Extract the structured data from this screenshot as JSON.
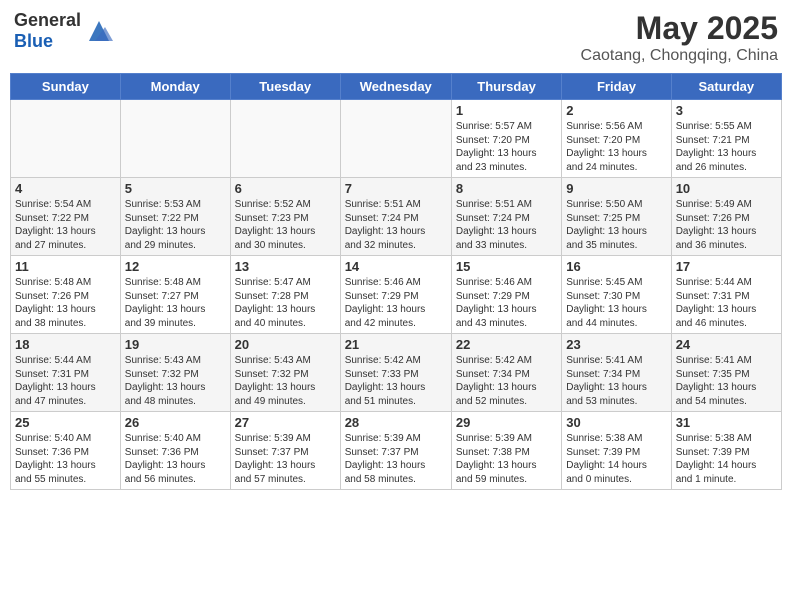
{
  "header": {
    "logo_general": "General",
    "logo_blue": "Blue",
    "month_title": "May 2025",
    "subtitle": "Caotang, Chongqing, China"
  },
  "days_of_week": [
    "Sunday",
    "Monday",
    "Tuesday",
    "Wednesday",
    "Thursday",
    "Friday",
    "Saturday"
  ],
  "weeks": [
    [
      {
        "day": "",
        "info": ""
      },
      {
        "day": "",
        "info": ""
      },
      {
        "day": "",
        "info": ""
      },
      {
        "day": "",
        "info": ""
      },
      {
        "day": "1",
        "info": "Sunrise: 5:57 AM\nSunset: 7:20 PM\nDaylight: 13 hours\nand 23 minutes."
      },
      {
        "day": "2",
        "info": "Sunrise: 5:56 AM\nSunset: 7:20 PM\nDaylight: 13 hours\nand 24 minutes."
      },
      {
        "day": "3",
        "info": "Sunrise: 5:55 AM\nSunset: 7:21 PM\nDaylight: 13 hours\nand 26 minutes."
      }
    ],
    [
      {
        "day": "4",
        "info": "Sunrise: 5:54 AM\nSunset: 7:22 PM\nDaylight: 13 hours\nand 27 minutes."
      },
      {
        "day": "5",
        "info": "Sunrise: 5:53 AM\nSunset: 7:22 PM\nDaylight: 13 hours\nand 29 minutes."
      },
      {
        "day": "6",
        "info": "Sunrise: 5:52 AM\nSunset: 7:23 PM\nDaylight: 13 hours\nand 30 minutes."
      },
      {
        "day": "7",
        "info": "Sunrise: 5:51 AM\nSunset: 7:24 PM\nDaylight: 13 hours\nand 32 minutes."
      },
      {
        "day": "8",
        "info": "Sunrise: 5:51 AM\nSunset: 7:24 PM\nDaylight: 13 hours\nand 33 minutes."
      },
      {
        "day": "9",
        "info": "Sunrise: 5:50 AM\nSunset: 7:25 PM\nDaylight: 13 hours\nand 35 minutes."
      },
      {
        "day": "10",
        "info": "Sunrise: 5:49 AM\nSunset: 7:26 PM\nDaylight: 13 hours\nand 36 minutes."
      }
    ],
    [
      {
        "day": "11",
        "info": "Sunrise: 5:48 AM\nSunset: 7:26 PM\nDaylight: 13 hours\nand 38 minutes."
      },
      {
        "day": "12",
        "info": "Sunrise: 5:48 AM\nSunset: 7:27 PM\nDaylight: 13 hours\nand 39 minutes."
      },
      {
        "day": "13",
        "info": "Sunrise: 5:47 AM\nSunset: 7:28 PM\nDaylight: 13 hours\nand 40 minutes."
      },
      {
        "day": "14",
        "info": "Sunrise: 5:46 AM\nSunset: 7:29 PM\nDaylight: 13 hours\nand 42 minutes."
      },
      {
        "day": "15",
        "info": "Sunrise: 5:46 AM\nSunset: 7:29 PM\nDaylight: 13 hours\nand 43 minutes."
      },
      {
        "day": "16",
        "info": "Sunrise: 5:45 AM\nSunset: 7:30 PM\nDaylight: 13 hours\nand 44 minutes."
      },
      {
        "day": "17",
        "info": "Sunrise: 5:44 AM\nSunset: 7:31 PM\nDaylight: 13 hours\nand 46 minutes."
      }
    ],
    [
      {
        "day": "18",
        "info": "Sunrise: 5:44 AM\nSunset: 7:31 PM\nDaylight: 13 hours\nand 47 minutes."
      },
      {
        "day": "19",
        "info": "Sunrise: 5:43 AM\nSunset: 7:32 PM\nDaylight: 13 hours\nand 48 minutes."
      },
      {
        "day": "20",
        "info": "Sunrise: 5:43 AM\nSunset: 7:32 PM\nDaylight: 13 hours\nand 49 minutes."
      },
      {
        "day": "21",
        "info": "Sunrise: 5:42 AM\nSunset: 7:33 PM\nDaylight: 13 hours\nand 51 minutes."
      },
      {
        "day": "22",
        "info": "Sunrise: 5:42 AM\nSunset: 7:34 PM\nDaylight: 13 hours\nand 52 minutes."
      },
      {
        "day": "23",
        "info": "Sunrise: 5:41 AM\nSunset: 7:34 PM\nDaylight: 13 hours\nand 53 minutes."
      },
      {
        "day": "24",
        "info": "Sunrise: 5:41 AM\nSunset: 7:35 PM\nDaylight: 13 hours\nand 54 minutes."
      }
    ],
    [
      {
        "day": "25",
        "info": "Sunrise: 5:40 AM\nSunset: 7:36 PM\nDaylight: 13 hours\nand 55 minutes."
      },
      {
        "day": "26",
        "info": "Sunrise: 5:40 AM\nSunset: 7:36 PM\nDaylight: 13 hours\nand 56 minutes."
      },
      {
        "day": "27",
        "info": "Sunrise: 5:39 AM\nSunset: 7:37 PM\nDaylight: 13 hours\nand 57 minutes."
      },
      {
        "day": "28",
        "info": "Sunrise: 5:39 AM\nSunset: 7:37 PM\nDaylight: 13 hours\nand 58 minutes."
      },
      {
        "day": "29",
        "info": "Sunrise: 5:39 AM\nSunset: 7:38 PM\nDaylight: 13 hours\nand 59 minutes."
      },
      {
        "day": "30",
        "info": "Sunrise: 5:38 AM\nSunset: 7:39 PM\nDaylight: 14 hours\nand 0 minutes."
      },
      {
        "day": "31",
        "info": "Sunrise: 5:38 AM\nSunset: 7:39 PM\nDaylight: 14 hours\nand 1 minute."
      }
    ]
  ]
}
